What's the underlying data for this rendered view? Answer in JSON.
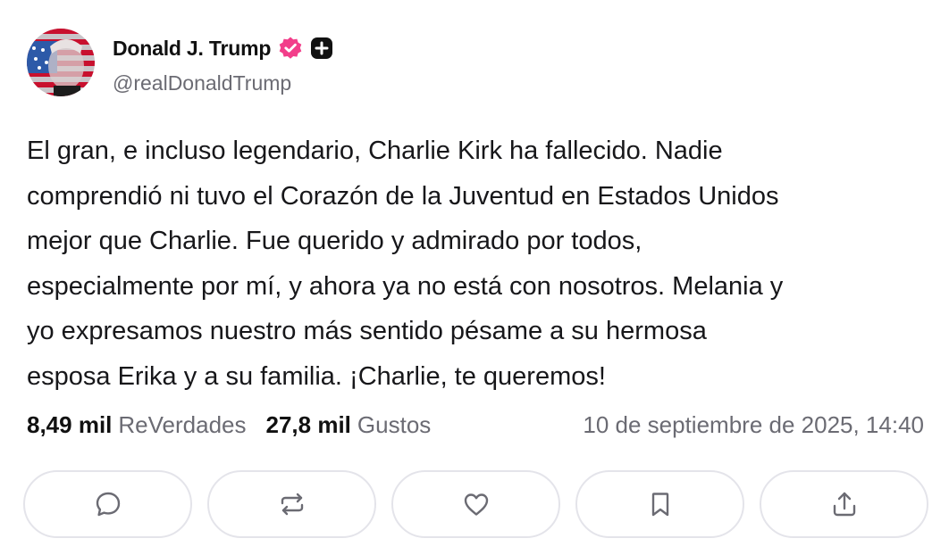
{
  "author": {
    "display_name": "Donald J. Trump",
    "handle": "@realDonaldTrump",
    "verified_badge_icon": "verified-check-badge-icon",
    "plus_badge_icon": "plus-badge-icon",
    "badge_color": "#f23e8a"
  },
  "post": {
    "text": "El gran, e incluso legendario, Charlie Kirk ha fallecido. Nadie\ncomprendió ni tuvo el Corazón de la Juventud en Estados Unidos\nmejor que Charlie. Fue querido y admirado por todos,\nespecialmente por mí, y ahora ya no está con nosotros. Melania y\nyo expresamos nuestro más sentido pésame a su hermosa\nesposa Erika y a su familia. ¡Charlie, te queremos!"
  },
  "stats": {
    "reposts_count": "8,49 mil",
    "reposts_label": "ReVerdades",
    "likes_count": "27,8 mil",
    "likes_label": "Gustos",
    "timestamp": "10 de septiembre de 2025, 14:40"
  },
  "actions": [
    {
      "name": "reply",
      "icon": "comment-bubble-icon"
    },
    {
      "name": "repost",
      "icon": "repost-arrows-icon"
    },
    {
      "name": "like",
      "icon": "heart-icon"
    },
    {
      "name": "bookmark",
      "icon": "bookmark-icon"
    },
    {
      "name": "share",
      "icon": "share-upload-icon"
    }
  ]
}
